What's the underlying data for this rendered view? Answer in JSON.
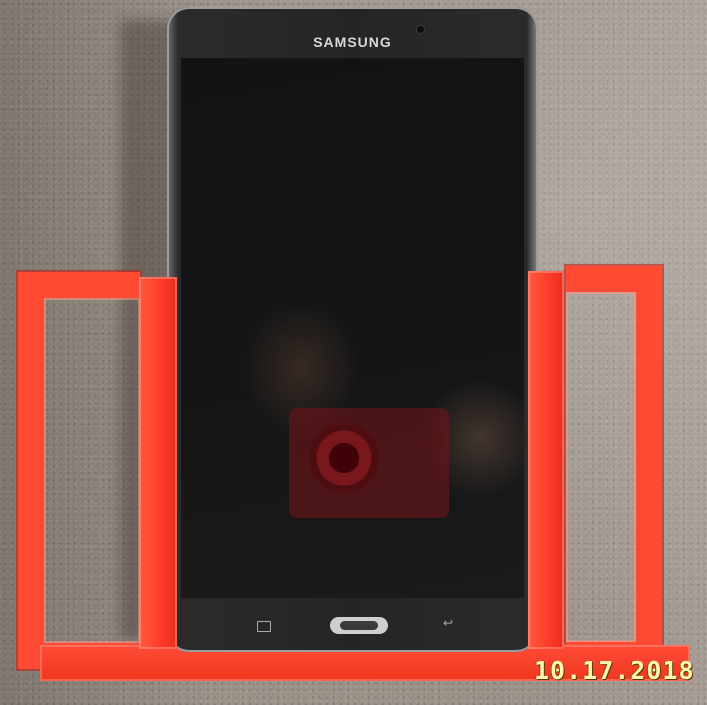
{
  "photo": {
    "tablet": {
      "brand": "SAMSUNG",
      "nav_icons": [
        "recent-apps-icon",
        "home-button",
        "back-icon"
      ]
    },
    "holder_color": "#ff4a34",
    "background_color": "#9a9087",
    "date_stamp": "10.17.2018"
  }
}
